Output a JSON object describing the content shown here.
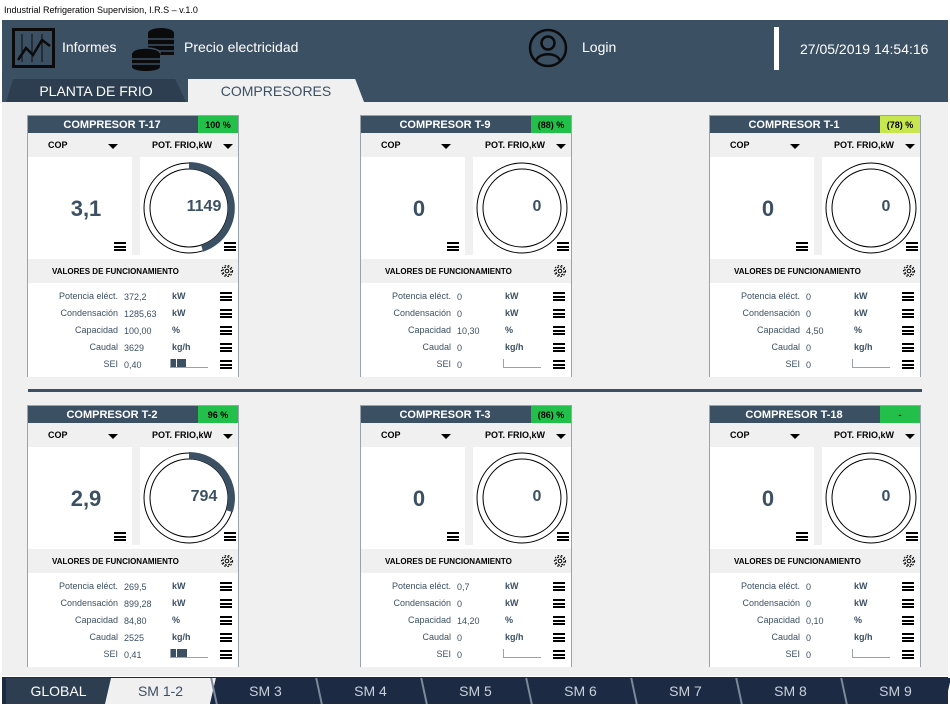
{
  "window": {
    "title": "Industrial Refrigeration Supervision, I.R.S – v.1.0"
  },
  "header": {
    "informes_label": "Informes",
    "precio_label": "Precio electricidad",
    "login_label": "Login",
    "datetime": "27/05/2019 14:54:16",
    "icons": [
      "chart-report-icon",
      "coins-icon",
      "user-icon"
    ],
    "bg_color": "#3c5064"
  },
  "top_tabs": [
    {
      "label": "PLANTA DE FRIO",
      "active": false
    },
    {
      "label": "COMPRESORES",
      "active": true
    }
  ],
  "cards": [
    {
      "title": "COMPRESOR T-17",
      "badge": "100 %",
      "badge_color": "#22c04a",
      "cop_label": "COP",
      "pot_label": "POT. FRIO,kW",
      "cop_value": "3,1",
      "gauge_value": "1149",
      "gauge_fraction": 0.45,
      "section_label": "VALORES DE FUNCIONAMIENTO",
      "metrics": [
        {
          "label": "Potencia eléct.",
          "value": "372,2",
          "unit": "kW"
        },
        {
          "label": "Condensación",
          "value": "1285,63",
          "unit": "kW"
        },
        {
          "label": "Capacidad",
          "value": "100,00",
          "unit": "%"
        },
        {
          "label": "Caudal",
          "value": "3629",
          "unit": "kg/h"
        },
        {
          "label": "SEI",
          "value": "0,40",
          "unit": "",
          "sei_fraction": 0.4
        }
      ]
    },
    {
      "title": "COMPRESOR T-9",
      "badge": "(88) %",
      "badge_color": "#22c04a",
      "cop_label": "COP",
      "pot_label": "POT. FRIO,kW",
      "cop_value": "0",
      "gauge_value": "0",
      "gauge_fraction": 0,
      "section_label": "VALORES DE FUNCIONAMIENTO",
      "metrics": [
        {
          "label": "Potencia eléct.",
          "value": "0",
          "unit": "kW"
        },
        {
          "label": "Condensación",
          "value": "0",
          "unit": "kW"
        },
        {
          "label": "Capacidad",
          "value": "10,30",
          "unit": "%"
        },
        {
          "label": "Caudal",
          "value": "0",
          "unit": "kg/h"
        },
        {
          "label": "SEI",
          "value": "0",
          "unit": "",
          "sei_fraction": 0
        }
      ]
    },
    {
      "title": "COMPRESOR T-1",
      "badge": "(78) %",
      "badge_color": "#c8e650",
      "cop_label": "COP",
      "pot_label": "POT. FRIO,kW",
      "cop_value": "0",
      "gauge_value": "0",
      "gauge_fraction": 0,
      "section_label": "VALORES DE FUNCIONAMIENTO",
      "metrics": [
        {
          "label": "Potencia eléct.",
          "value": "0",
          "unit": "kW"
        },
        {
          "label": "Condensación",
          "value": "0",
          "unit": "kW"
        },
        {
          "label": "Capacidad",
          "value": "4,50",
          "unit": "%"
        },
        {
          "label": "Caudal",
          "value": "0",
          "unit": "kg/h"
        },
        {
          "label": "SEI",
          "value": "0",
          "unit": "",
          "sei_fraction": 0
        }
      ]
    },
    {
      "title": "COMPRESOR T-2",
      "badge": "96 %",
      "badge_color": "#22c04a",
      "cop_label": "COP",
      "pot_label": "POT. FRIO,kW",
      "cop_value": "2,9",
      "gauge_value": "794",
      "gauge_fraction": 0.3,
      "section_label": "VALORES DE FUNCIONAMIENTO",
      "metrics": [
        {
          "label": "Potencia eléct.",
          "value": "269,5",
          "unit": "kW"
        },
        {
          "label": "Condensación",
          "value": "899,28",
          "unit": "kW"
        },
        {
          "label": "Capacidad",
          "value": "84,80",
          "unit": "%"
        },
        {
          "label": "Caudal",
          "value": "2525",
          "unit": "kg/h"
        },
        {
          "label": "SEI",
          "value": "0,41",
          "unit": "",
          "sei_fraction": 0.41
        }
      ]
    },
    {
      "title": "COMPRESOR T-3",
      "badge": "(86) %",
      "badge_color": "#22c04a",
      "cop_label": "COP",
      "pot_label": "POT. FRIO,kW",
      "cop_value": "0",
      "gauge_value": "0",
      "gauge_fraction": 0,
      "section_label": "VALORES DE FUNCIONAMIENTO",
      "metrics": [
        {
          "label": "Potencia eléct.",
          "value": "0,7",
          "unit": "kW"
        },
        {
          "label": "Condensación",
          "value": "0",
          "unit": "kW"
        },
        {
          "label": "Capacidad",
          "value": "14,20",
          "unit": "%"
        },
        {
          "label": "Caudal",
          "value": "0",
          "unit": "kg/h"
        },
        {
          "label": "SEI",
          "value": "0",
          "unit": "",
          "sei_fraction": 0
        }
      ]
    },
    {
      "title": "COMPRESOR T-18",
      "badge": "-",
      "badge_color": "#22c04a",
      "cop_label": "COP",
      "pot_label": "POT. FRIO,kW",
      "cop_value": "0",
      "gauge_value": "0",
      "gauge_fraction": 0,
      "section_label": "VALORES DE FUNCIONAMIENTO",
      "metrics": [
        {
          "label": "Potencia eléct.",
          "value": "0",
          "unit": "kW"
        },
        {
          "label": "Condensación",
          "value": "0",
          "unit": "kW"
        },
        {
          "label": "Capacidad",
          "value": "0,10",
          "unit": "%"
        },
        {
          "label": "Caudal",
          "value": "0",
          "unit": "kg/h"
        },
        {
          "label": "SEI",
          "value": "0",
          "unit": "",
          "sei_fraction": 0
        }
      ]
    }
  ],
  "bottom_tabs": [
    {
      "label": "GLOBAL",
      "active": false
    },
    {
      "label": "SM 1-2",
      "active": true
    },
    {
      "label": "SM 3",
      "active": false
    },
    {
      "label": "SM 4",
      "active": false
    },
    {
      "label": "SM 5",
      "active": false
    },
    {
      "label": "SM 6",
      "active": false
    },
    {
      "label": "SM 7",
      "active": false
    },
    {
      "label": "SM 8",
      "active": false
    },
    {
      "label": "SM 9",
      "active": false
    }
  ]
}
